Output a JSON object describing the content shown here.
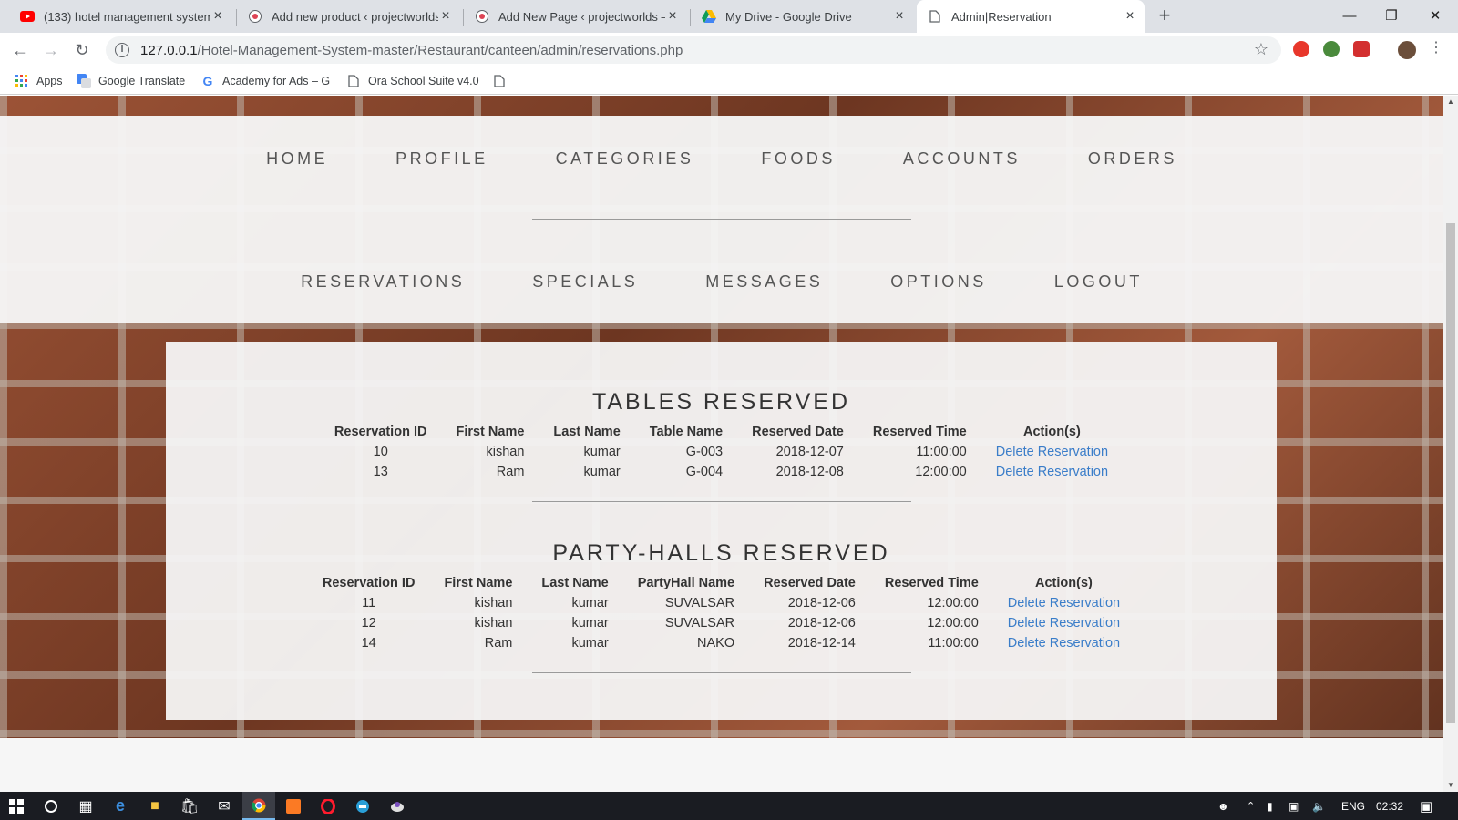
{
  "browser": {
    "tabs": [
      {
        "title": "(133) hotel management system",
        "icon": "youtube-icon",
        "active": false
      },
      {
        "title": "Add new product ‹ projectworlds",
        "icon": "wordpress-icon",
        "active": false
      },
      {
        "title": "Add New Page ‹ projectworlds —",
        "icon": "wordpress-icon",
        "active": false
      },
      {
        "title": "My Drive - Google Drive",
        "icon": "google-drive-icon",
        "active": false
      },
      {
        "title": "Admin|Reservation",
        "icon": "page-icon",
        "active": true
      }
    ],
    "url_host": "127.0.0.1",
    "url_path": "/Hotel-Management-System-master/Restaurant/canteen/admin/reservations.php",
    "bookmarks": [
      {
        "label": "Apps",
        "icon": "apps-grid-icon"
      },
      {
        "label": "Google Translate",
        "icon": "google-translate-icon"
      },
      {
        "label": "Academy for Ads – G",
        "icon": "google-g-icon"
      },
      {
        "label": "Ora School Suite v4.0",
        "icon": "page-icon"
      },
      {
        "label": "",
        "icon": "page-icon"
      }
    ]
  },
  "nav": {
    "row1": [
      "HOME",
      "PROFILE",
      "CATEGORIES",
      "FOODS",
      "ACCOUNTS",
      "ORDERS"
    ],
    "row2": [
      "RESERVATIONS",
      "SPECIALS",
      "MESSAGES",
      "OPTIONS",
      "LOGOUT"
    ]
  },
  "tables_section": {
    "title": "TABLES RESERVED",
    "headers": [
      "Reservation ID",
      "First Name",
      "Last Name",
      "Table Name",
      "Reserved Date",
      "Reserved Time",
      "Action(s)"
    ],
    "rows": [
      [
        "10",
        "kishan",
        "kumar",
        "G-003",
        "2018-12-07",
        "11:00:00",
        "Delete Reservation"
      ],
      [
        "13",
        "Ram",
        "kumar",
        "G-004",
        "2018-12-08",
        "12:00:00",
        "Delete Reservation"
      ]
    ]
  },
  "halls_section": {
    "title": "PARTY-HALLS RESERVED",
    "headers": [
      "Reservation ID",
      "First Name",
      "Last Name",
      "PartyHall Name",
      "Reserved Date",
      "Reserved Time",
      "Action(s)"
    ],
    "rows": [
      [
        "11",
        "kishan",
        "kumar",
        "SUVALSAR",
        "2018-12-06",
        "12:00:00",
        "Delete Reservation"
      ],
      [
        "12",
        "kishan",
        "kumar",
        "SUVALSAR",
        "2018-12-06",
        "12:00:00",
        "Delete Reservation"
      ],
      [
        "14",
        "Ram",
        "kumar",
        "NAKO",
        "2018-12-14",
        "11:00:00",
        "Delete Reservation"
      ]
    ]
  },
  "taskbar": {
    "language": "ENG",
    "time": "02:32"
  },
  "colors": {
    "link": "#3a7dc9",
    "nav_text": "#555555",
    "panel": "#f6f6f6"
  }
}
